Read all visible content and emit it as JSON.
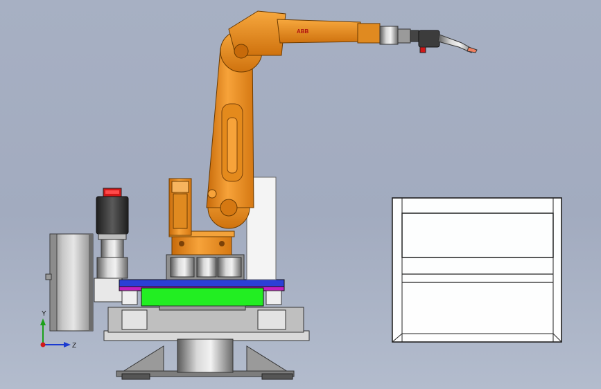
{
  "viewport": {
    "background_top": "#a7b0c3",
    "background_bottom": "#b3bccd"
  },
  "robot": {
    "brand_label": "ABB",
    "color": "#f0901c"
  },
  "triad": {
    "y_label": "Y",
    "z_label": "Z"
  },
  "colors": {
    "table_top": "#2b3fd6",
    "table_body": "#22ee22",
    "accent_magenta": "#c020c0",
    "cap_red": "#d01818",
    "frame_line": "#222222"
  }
}
